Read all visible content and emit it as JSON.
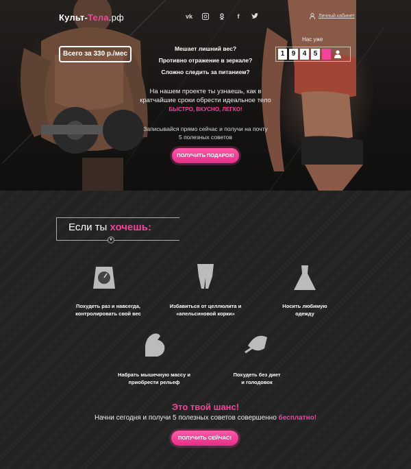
{
  "header": {
    "logo_part1": "Культ-",
    "logo_part2": "Тела",
    "logo_part3": ".рф",
    "socials": [
      "vk-icon",
      "instagram-icon",
      "odnoklassniki-icon",
      "facebook-icon",
      "twitter-icon"
    ],
    "cabinet_label": "Личный кабинет"
  },
  "hero": {
    "price": "Всего за 330 р./мес",
    "questions": [
      "Мешает лишний вес?",
      "Противно отражение в зеркале?",
      "Сложно следить за питанием?"
    ],
    "counter_label": "Нас уже",
    "counter_digits": [
      "1",
      "9",
      "4",
      "5"
    ],
    "pitch_line1": "На нашем проекте ты узнаешь, как в",
    "pitch_line2": "кратчайшие сроки обрести идеальное тело",
    "pitch_highlight": "БЫСТРО, ВКУСНО, ЛЕГКО!",
    "sub_line1": "Записывайся прямо сейчас и получи на почту",
    "sub_line2": "5 полезных советов",
    "gift_button": "ПОЛУЧИТЬ ПОДАРОК!"
  },
  "wants": {
    "title_plain": "Если ты ",
    "title_pink": "хочешь:",
    "items": [
      {
        "line1": "Похудеть раз и навсегда,",
        "line2": "контролировать свой вес"
      },
      {
        "line1": "Избавиться от целлюлита и",
        "line2": "«апельсиновой корки»"
      },
      {
        "line1": "Носить любимую",
        "line2": "одежду"
      },
      {
        "line1": "Набрать мышечную массу и",
        "line2": "приобрести рельеф"
      },
      {
        "line1": "Похудеть без диет",
        "line2": "и голодовок"
      }
    ]
  },
  "cta": {
    "chance": "Это твой шанс!",
    "start_plain": "Начни сегодня и получи 5 полезных советов совершенно ",
    "start_pink": "бесплатно!",
    "now_button": "ПОЛУЧИТЬ СЕЙЧАС!"
  },
  "colors": {
    "accent": "#f0459a",
    "background": "#222222"
  }
}
